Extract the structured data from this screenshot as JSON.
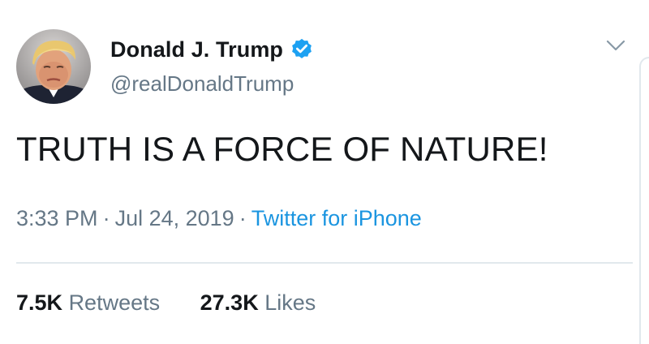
{
  "author": {
    "display_name": "Donald J. Trump",
    "handle": "@realDonaldTrump",
    "verified": true,
    "avatar_icon": "profile-photo"
  },
  "tweet": {
    "text": "TRUTH IS A FORCE OF NATURE!",
    "time": "3:33 PM",
    "separator": "·",
    "date": "Jul 24, 2019",
    "source": "Twitter for iPhone"
  },
  "stats": {
    "retweets_count": "7.5K",
    "retweets_label": "Retweets",
    "likes_count": "27.3K",
    "likes_label": "Likes"
  },
  "colors": {
    "accent": "#1b95e0",
    "verified_badge": "#1da1f2",
    "text_primary": "#14171a",
    "text_secondary": "#657786",
    "divider": "#e1e8ed"
  },
  "icons": {
    "verified": "verified-badge-icon",
    "menu": "chevron-down-icon"
  }
}
